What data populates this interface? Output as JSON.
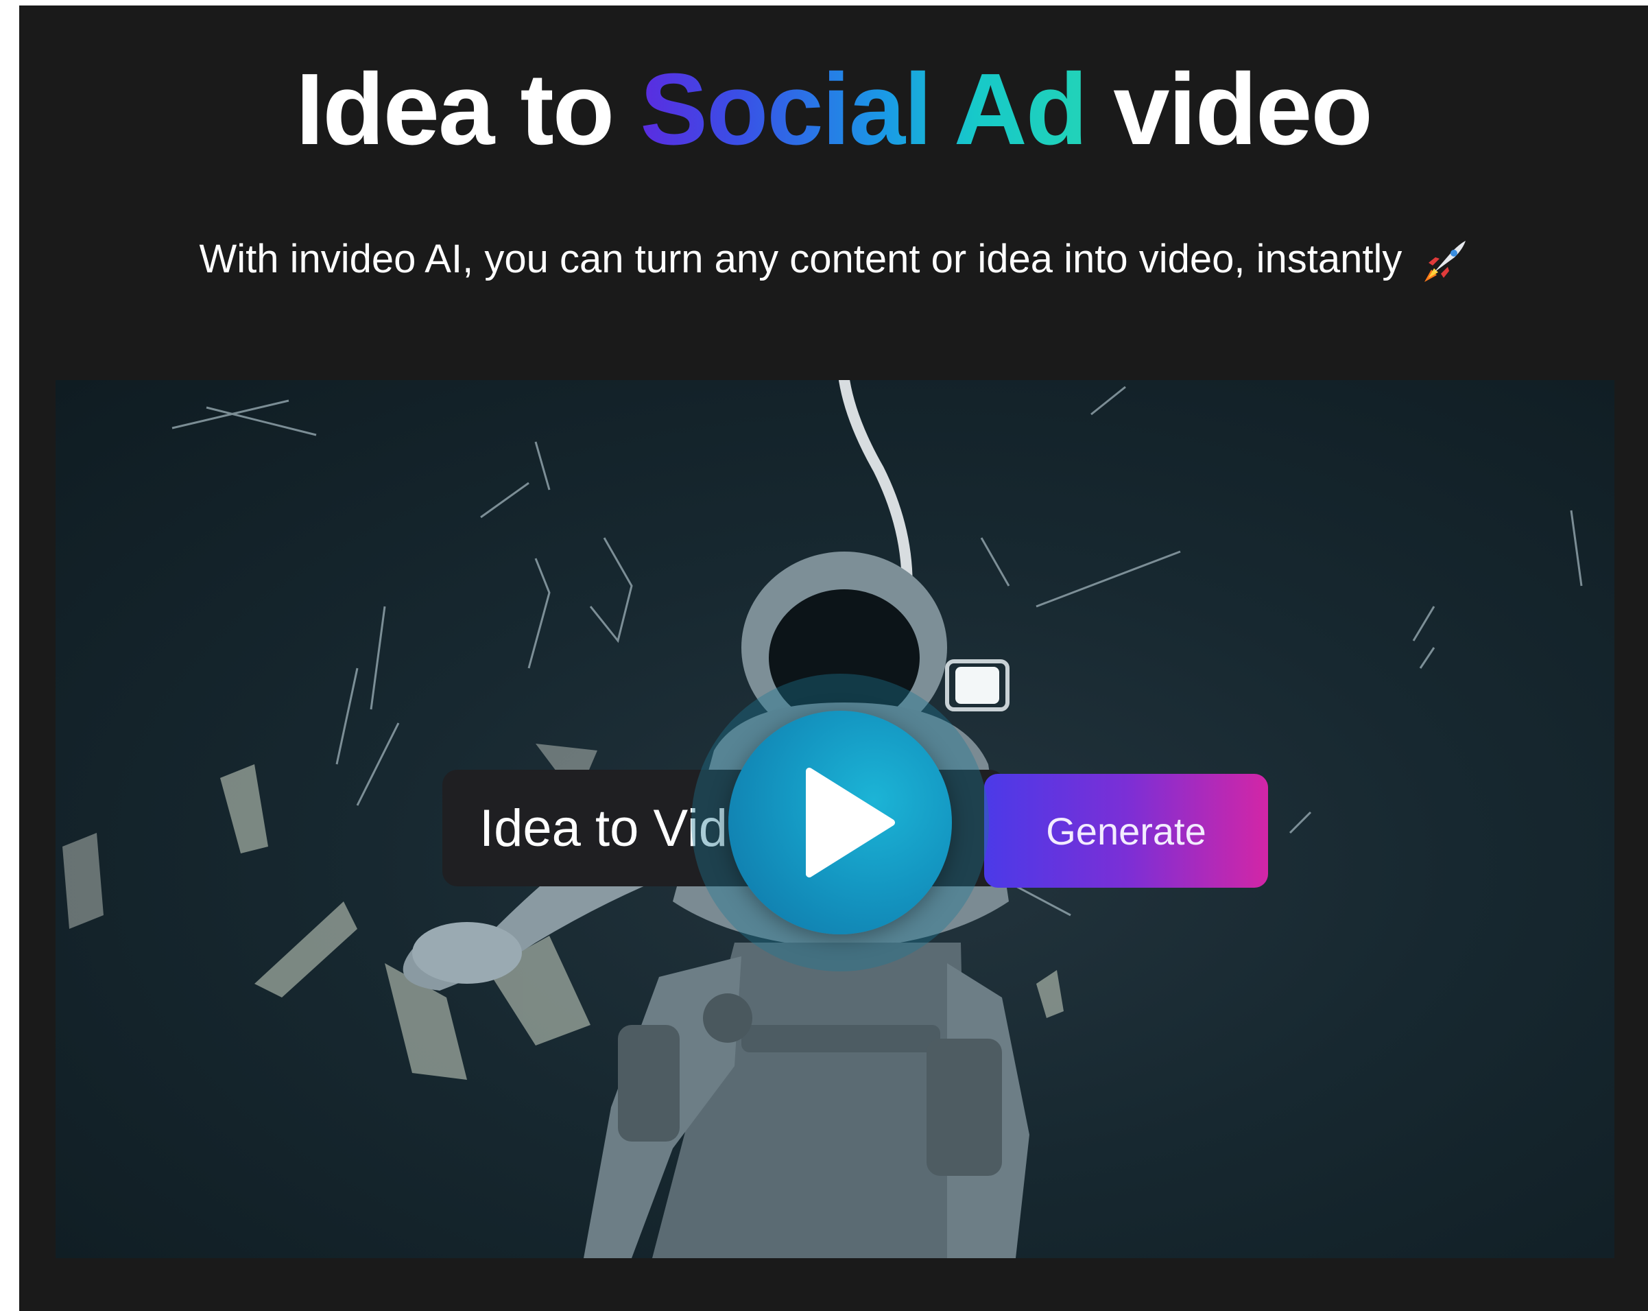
{
  "hero": {
    "headline_part1": "Idea to ",
    "headline_highlight": "Social Ad",
    "headline_part2": " video",
    "subline": "With invideo AI, you can turn any content or idea into video, instantly",
    "subline_icon": "rocket-icon"
  },
  "video": {
    "prompt_text": "Idea to Video",
    "generate_label": "Generate",
    "play_icon": "play-icon",
    "accent_colors": {
      "gradient_start": "#5b2ce0",
      "gradient_mid": "#1a9ae6",
      "gradient_end": "#22d3b8",
      "generate_start": "#4b3ae8",
      "generate_end": "#d326a6",
      "play": "#1497c2"
    }
  }
}
